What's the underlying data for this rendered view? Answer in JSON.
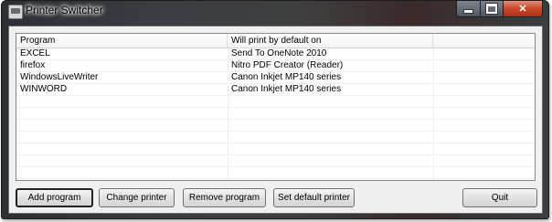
{
  "window": {
    "title": "Printer Switcher"
  },
  "list": {
    "columns": [
      "Program",
      "Will print by default on"
    ],
    "rows": [
      {
        "program": "EXCEL",
        "printer": "Send To OneNote 2010"
      },
      {
        "program": "firefox",
        "printer": "Nitro PDF Creator (Reader)"
      },
      {
        "program": "WindowsLiveWriter",
        "printer": "Canon Inkjet MP140 series"
      },
      {
        "program": "WINWORD",
        "printer": "Canon Inkjet MP140 series"
      }
    ]
  },
  "buttons": {
    "add": "Add program",
    "change": "Change printer",
    "remove": "Remove program",
    "set_default": "Set default printer",
    "quit": "Quit"
  }
}
